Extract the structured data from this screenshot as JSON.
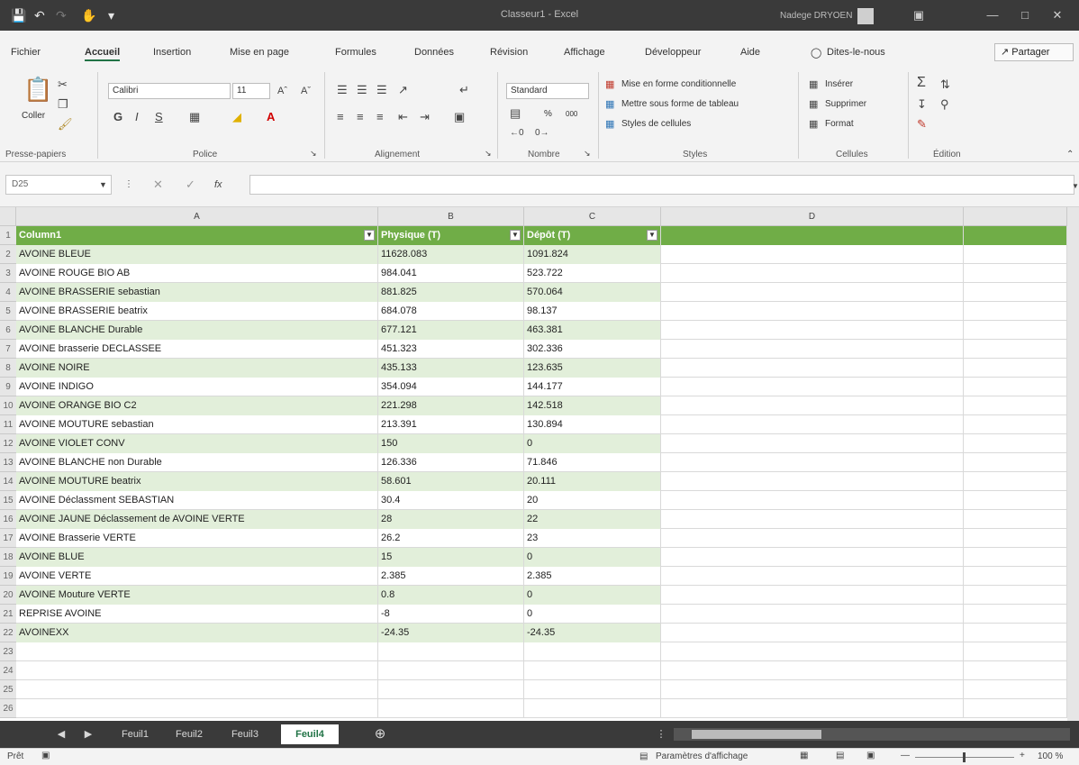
{
  "window": {
    "title": "Classeur1 - Excel",
    "user": "Nadege DRYOEN"
  },
  "menu": [
    "Fichier",
    "Accueil",
    "Insertion",
    "Mise en page",
    "Formules",
    "Données",
    "Révision",
    "Affichage",
    "Développeur",
    "Aide",
    "Dites-le-nous"
  ],
  "menu_active": "Accueil",
  "share_label": "Partager",
  "ribbon": {
    "clipboard": {
      "paste": "Coller",
      "group": "Presse-papiers"
    },
    "font": {
      "name": "Calibri",
      "size": "11",
      "bold": "G",
      "italic": "I",
      "underline": "S",
      "group": "Police"
    },
    "alignment": {
      "group": "Alignement"
    },
    "number": {
      "format": "Standard",
      "percent": "%",
      "thousands": "000",
      "group": "Nombre"
    },
    "styles": {
      "conditional": "Mise en forme conditionnelle",
      "table": "Mettre sous forme de tableau",
      "cell_styles": "Styles de cellules",
      "group": "Styles"
    },
    "cells": {
      "insert": "Insérer",
      "delete": "Supprimer",
      "format": "Format",
      "group": "Cellules"
    },
    "editing": {
      "group": "Édition"
    }
  },
  "formula_bar": {
    "name_box": "D25",
    "fx": "fx",
    "value": ""
  },
  "columns": [
    "A",
    "B",
    "C",
    "D"
  ],
  "table_headers": [
    "Column1",
    "Physique (T)",
    "Dépôt (T)"
  ],
  "rows": [
    [
      "AVOINE BLEUE",
      "11628.083",
      "1091.824"
    ],
    [
      "AVOINE ROUGE BIO AB",
      "984.041",
      "523.722"
    ],
    [
      "AVOINE BRASSERIE sebastian",
      "881.825",
      "570.064"
    ],
    [
      "AVOINE BRASSERIE beatrix",
      "684.078",
      "98.137"
    ],
    [
      "AVOINE BLANCHE Durable",
      "677.121",
      "463.381"
    ],
    [
      "AVOINE brasserie DECLASSEE",
      "451.323",
      "302.336"
    ],
    [
      "AVOINE NOIRE",
      "435.133",
      "123.635"
    ],
    [
      "AVOINE INDIGO",
      "354.094",
      "144.177"
    ],
    [
      "AVOINE ORANGE BIO C2",
      "221.298",
      "142.518"
    ],
    [
      "AVOINE MOUTURE sebastian",
      "213.391",
      "130.894"
    ],
    [
      "AVOINE VIOLET CONV",
      "150",
      "0"
    ],
    [
      "AVOINE BLANCHE non Durable",
      "126.336",
      "71.846"
    ],
    [
      "AVOINE MOUTURE beatrix",
      "58.601",
      "20.111"
    ],
    [
      "AVOINE Déclassment SEBASTIAN",
      "30.4",
      "20"
    ],
    [
      "AVOINE JAUNE Déclassement de AVOINE VERTE",
      "28",
      "22"
    ],
    [
      "AVOINE Brasserie VERTE",
      "26.2",
      "23"
    ],
    [
      "AVOINE BLUE",
      "15",
      "0"
    ],
    [
      "AVOINE VERTE",
      "2.385",
      "2.385"
    ],
    [
      "AVOINE Mouture VERTE",
      "0.8",
      "0"
    ],
    [
      "REPRISE AVOINE",
      "-8",
      "0"
    ],
    [
      "AVOINEXX",
      "-24.35",
      "-24.35"
    ]
  ],
  "row_numbers": [
    "1",
    "2",
    "3",
    "4",
    "5",
    "6",
    "7",
    "8",
    "9",
    "10",
    "11",
    "12",
    "13",
    "14",
    "15",
    "16",
    "17",
    "18",
    "19",
    "20",
    "21",
    "22",
    "23",
    "24",
    "25",
    "26"
  ],
  "sheets": [
    "Feuil1",
    "Feuil2",
    "Feuil3",
    "Feuil4"
  ],
  "active_sheet": "Feuil4",
  "status": {
    "ready": "Prêt",
    "display_settings": "Paramètres d'affichage",
    "zoom": "100 %"
  },
  "colors": {
    "header_green": "#70ad47",
    "band_green": "#e2efda",
    "excel_green": "#217346",
    "titlebar": "#3a3a3a"
  }
}
